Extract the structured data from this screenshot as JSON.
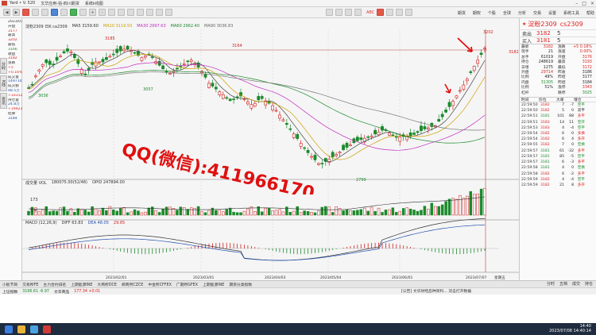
{
  "titlebar": {
    "items": [
      "Yard • V. 520",
      "文华应用-拍-四川期货",
      "系统k线图"
    ]
  },
  "toolbar": {
    "abc": "ABC",
    "menu_right": [
      "期货",
      "期权",
      "个股",
      "全球",
      "分析",
      "交易",
      "设置",
      "系统工具",
      "帮助"
    ]
  },
  "sidebar": {
    "tab_labels": [
      "分时",
      "K线",
      "资讯"
    ],
    "rows": [
      {
        "t": "2023/07/07",
        "c": "lbl"
      },
      {
        "t": "开盘",
        "c": "lbl"
      },
      {
        "t": "3177",
        "c": "up"
      },
      {
        "t": "最高",
        "c": "lbl"
      },
      {
        "t": "3202",
        "c": "up"
      },
      {
        "t": "最低",
        "c": "lbl"
      },
      {
        "t": "3166",
        "c": "dn"
      },
      {
        "t": "收盘",
        "c": "lbl"
      },
      {
        "t": "3182",
        "c": "up"
      },
      {
        "t": "涨跌",
        "c": "lbl"
      },
      {
        "t": "+5",
        "c": "up"
      },
      {
        "t": "+0.16%",
        "c": "up"
      },
      {
        "t": "成交量",
        "c": "lbl"
      },
      {
        "t": "149710",
        "c": "bl"
      },
      {
        "t": "成交额",
        "c": "lbl"
      },
      {
        "t": "48.5万",
        "c": "bl"
      },
      {
        "t": "+33312",
        "c": "up"
      },
      {
        "t": "持仓量",
        "c": "lbl"
      },
      {
        "t": "24.8万",
        "c": "bl"
      },
      {
        "t": "+19923",
        "c": "up"
      },
      {
        "t": "结算",
        "c": "lbl"
      },
      {
        "t": "3184",
        "c": "bl"
      }
    ]
  },
  "chart": {
    "legend_main": [
      {
        "t": "淀粉2309  日K  ca2309",
        "color": "#333333"
      },
      {
        "t": "MA5 3159.60",
        "color": "#333333"
      },
      {
        "t": "MA10 3119.50",
        "color": "#d0a000"
      },
      {
        "t": "MA30 2997.63",
        "color": "#c02cc0"
      },
      {
        "t": "MA60 2962.40",
        "color": "#1a8a2a"
      },
      {
        "t": "MA90 3036.83",
        "color": "#666666"
      }
    ],
    "legend_vol": [
      {
        "t": "成交量 VOL",
        "color": "#333333"
      },
      {
        "t": "180075.00(52/48)",
        "color": "#333333"
      },
      {
        "t": "OPID 247894.00",
        "color": "#333333"
      }
    ],
    "legend_macd": [
      {
        "t": "MACD (12,26,9)",
        "color": "#333333"
      },
      {
        "t": "DIFF 63.83",
        "color": "#333333"
      },
      {
        "t": "DEA 48.05",
        "color": "#1f4fb0"
      },
      {
        "t": "29.65",
        "color": "#d22222"
      }
    ],
    "price_labels": {
      "p3185": "3185",
      "p3164": "3164",
      "p3036": "3036",
      "p3057": "3057",
      "p2799": "2799",
      "p3202": "3202",
      "p3182": "3182"
    },
    "vol_tick": "173",
    "vol_unit": "万手",
    "date_labels": [
      "2023/02/01",
      "2023/03/01",
      "2023/04/03",
      "2023/05/04",
      "2023/06/01",
      "2023/07/07",
      "星期五"
    ],
    "watermark": "QQ(微信):411966170"
  },
  "right": {
    "title": "淀粉2309",
    "code": "cs2309",
    "bid": {
      "k": "卖出",
      "p": "3182",
      "v": "5"
    },
    "ask": {
      "k": "买入",
      "p": "3181",
      "v": "5"
    },
    "stats": [
      {
        "a": "最新",
        "b": "3182",
        "bc": "red",
        "c": "涨跌",
        "d": "+5 0.16%",
        "dc": "red"
      },
      {
        "a": "现手",
        "b": "21",
        "bc": "blk",
        "c": "涨速",
        "d": "0.00%",
        "dc": "red"
      },
      {
        "a": "总手",
        "b": "61019",
        "bc": "blk",
        "c": "开盘",
        "d": "3176",
        "dc": "red"
      },
      {
        "a": "持仓",
        "b": "248619",
        "bc": "blk",
        "c": "最高",
        "d": "3193",
        "dc": "red"
      },
      {
        "a": "日增",
        "b": "1275",
        "bc": "blk",
        "c": "最低",
        "d": "3172",
        "dc": "red"
      },
      {
        "a": "外盘",
        "b": "29714",
        "bc": "red",
        "c": "昨收",
        "d": "3186",
        "dc": "blk"
      },
      {
        "a": "比例",
        "b": "49%",
        "bc": "blk",
        "c": "昨结",
        "d": "3177",
        "dc": "blk"
      },
      {
        "a": "内盘",
        "b": "31305",
        "bc": "grn",
        "c": "昨结",
        "d": "3184",
        "dc": "blk"
      },
      {
        "a": "比例",
        "b": "51%",
        "bc": "blk",
        "c": "涨停",
        "d": "3343",
        "dc": "red"
      },
      {
        "a": "杠杆",
        "b": "",
        "bc": "blk",
        "c": "跌停",
        "d": "3025",
        "dc": "grn"
      }
    ],
    "tick_head": [
      "时间",
      "价位",
      "大单",
      "增仓"
    ],
    "ticks": [
      {
        "t": "22:59:50",
        "p": "3182",
        "v": "7",
        "o": "-7",
        "n": "空平",
        "pc": "red",
        "nc": "grn"
      },
      {
        "t": "22:59:50",
        "p": "3182",
        "v": "5",
        "o": "0",
        "n": "双平",
        "pc": "red",
        "nc": "blk"
      },
      {
        "t": "22:59:51",
        "p": "3181",
        "v": "101",
        "o": "88",
        "n": "多平",
        "pc": "grn",
        "nc": "red"
      },
      {
        "t": "22:59:51",
        "p": "3183",
        "v": "14",
        "o": "11",
        "n": "空开",
        "pc": "red",
        "nc": "grn"
      },
      {
        "t": "22:59:53",
        "p": "3183",
        "v": "4",
        "o": "-4",
        "n": "空平",
        "pc": "red",
        "nc": "grn"
      },
      {
        "t": "22:59:54",
        "p": "3182",
        "v": "6",
        "o": "0",
        "n": "多换",
        "pc": "red",
        "nc": "red"
      },
      {
        "t": "22:59:54",
        "p": "3182",
        "v": "6",
        "o": "4",
        "n": "多开",
        "pc": "red",
        "nc": "red"
      },
      {
        "t": "22:59:55",
        "p": "3182",
        "v": "7",
        "o": "0",
        "n": "空换",
        "pc": "red",
        "nc": "grn"
      },
      {
        "t": "22:59:57",
        "p": "3181",
        "v": "61",
        "o": "-32",
        "n": "多平",
        "pc": "grn",
        "nc": "red"
      },
      {
        "t": "22:59:57",
        "p": "3181",
        "v": "85",
        "o": "-5",
        "n": "空平",
        "pc": "grn",
        "nc": "grn"
      },
      {
        "t": "22:59:57",
        "p": "3181",
        "v": "6",
        "o": "-3",
        "n": "多平",
        "pc": "grn",
        "nc": "red"
      },
      {
        "t": "22:59:58",
        "p": "3181",
        "v": "4",
        "o": "0",
        "n": "空换",
        "pc": "grn",
        "nc": "grn"
      },
      {
        "t": "22:59:58",
        "p": "3182",
        "v": "6",
        "o": "-2",
        "n": "多平",
        "pc": "red",
        "nc": "red"
      },
      {
        "t": "22:59:59",
        "p": "3182",
        "v": "4",
        "o": "-4",
        "n": "空平",
        "pc": "red",
        "nc": "grn"
      },
      {
        "t": "22:59:59",
        "p": "3182",
        "v": "21",
        "o": "8",
        "n": "多开",
        "pc": "red",
        "nc": "red"
      }
    ]
  },
  "bottom_tabs": [
    "小板节目",
    "交易所FE",
    "主力合约排名",
    "上期能源INE",
    "大商所DCE",
    "郑商所CZCE",
    "中金所CFFEX",
    "广期所GFEX",
    "上期能源INE",
    "期货分类指数"
  ],
  "bottom_right": [
    "分时",
    "五档",
    "成交",
    "持仓"
  ],
  "statusbar": [
    {
      "t": "上证指数",
      "c": "blk"
    },
    {
      "t": "3196.61  -6.97",
      "c": "grn"
    },
    {
      "t": "文华商品",
      "c": "blk"
    },
    {
      "t": "177.34  +0.01",
      "c": "red"
    }
  ],
  "status_msg": "[公告] 文华财经品种资料...  双击打开数据",
  "taskbar": {
    "time": "14:40",
    "date": "2023/07/08 14:40:14"
  }
}
